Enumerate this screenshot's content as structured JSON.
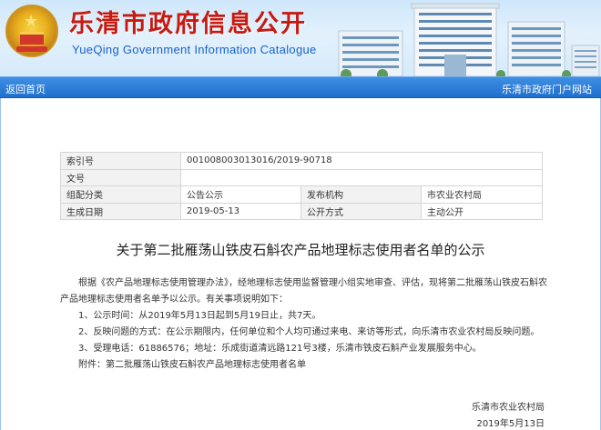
{
  "header": {
    "title": "乐清市政府信息公开",
    "subtitle": "YueQing Government Information Catalogue"
  },
  "nav": {
    "back_home": "返回首页",
    "portal": "乐清市政府门户网站"
  },
  "meta": {
    "index_label": "索引号",
    "index_value": "001008003013016/2019-90718",
    "doc_no_label": "文号",
    "doc_no_value": "",
    "category_label": "组配分类",
    "category_value": "公告公示",
    "publisher_label": "发布机构",
    "publisher_value": "市农业农村局",
    "date_label": "生成日期",
    "date_value": "2019-05-13",
    "public_method_label": "公开方式",
    "public_method_value": "主动公开"
  },
  "document": {
    "title": "关于第二批雁荡山铁皮石斛农产品地理标志使用者名单的公示",
    "paragraph": "根据《农产品地理标志使用管理办法》，经地理标志使用监督管理小组实地审查、评估，现将第二批雁荡山铁皮石斛农产品地理标志使用者名单予以公示。有关事项说明如下：",
    "items": [
      "1、公示时间：从2019年5月13日起到5月19日止，共7天。",
      "2、反映问题的方式：在公示期限内，任何单位和个人均可通过来电、来访等形式，向乐清市农业农村局反映问题。",
      "3、受理电话：61886576；地址：乐成街道清远路121号3楼，乐清市铁皮石斛产业发展服务中心。",
      "附件：第二批雁荡山铁皮石斛农产品地理标志使用者名单"
    ],
    "signature_org": "乐清市农业农村局",
    "signature_date": "2019年5月13日"
  },
  "colors": {
    "title_red": "#c61a12",
    "subtitle_blue": "#1b62c9",
    "nav_blue": "#1f6fce"
  }
}
